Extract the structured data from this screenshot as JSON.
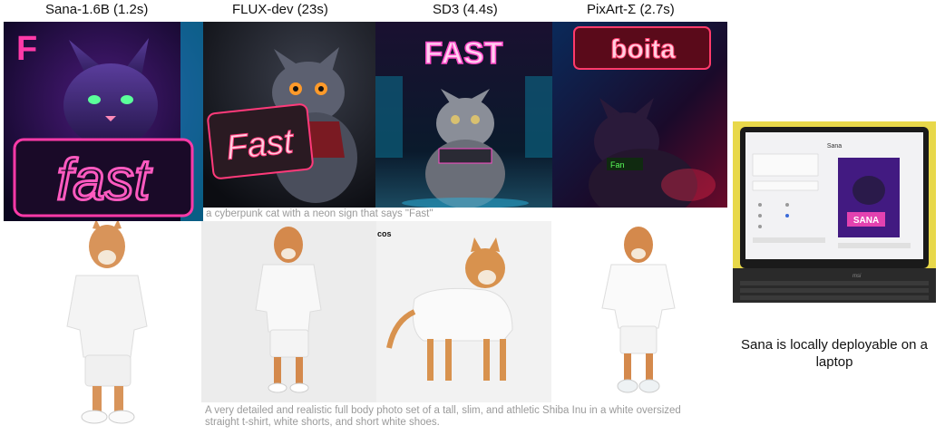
{
  "header": {
    "models": [
      {
        "name": "Sana-1.6B (1.2s)"
      },
      {
        "name": "FLUX-dev (23s)"
      },
      {
        "name": "SD3 (4.4s)"
      },
      {
        "name": "PixArt-Σ (2.7s)"
      }
    ]
  },
  "row1": {
    "signs": [
      "fast",
      "Fast",
      "FAST",
      "ɓoita"
    ],
    "small_sign_letter": "F",
    "cat_tag": "Fan",
    "prompt": "a cyberpunk cat with a neon sign that says \"Fast\""
  },
  "row2": {
    "cos_label": "cos",
    "prompt": "A very detailed and realistic full body photo set of a tall, slim, and athletic Shiba Inu in a white oversized straight t-shirt, white shorts, and short white shoes."
  },
  "laptop": {
    "screen_title": "Sana",
    "screen_badge": "SANA",
    "keyboard_brand": "msi",
    "caption": "Sana is locally deployable on a laptop"
  }
}
